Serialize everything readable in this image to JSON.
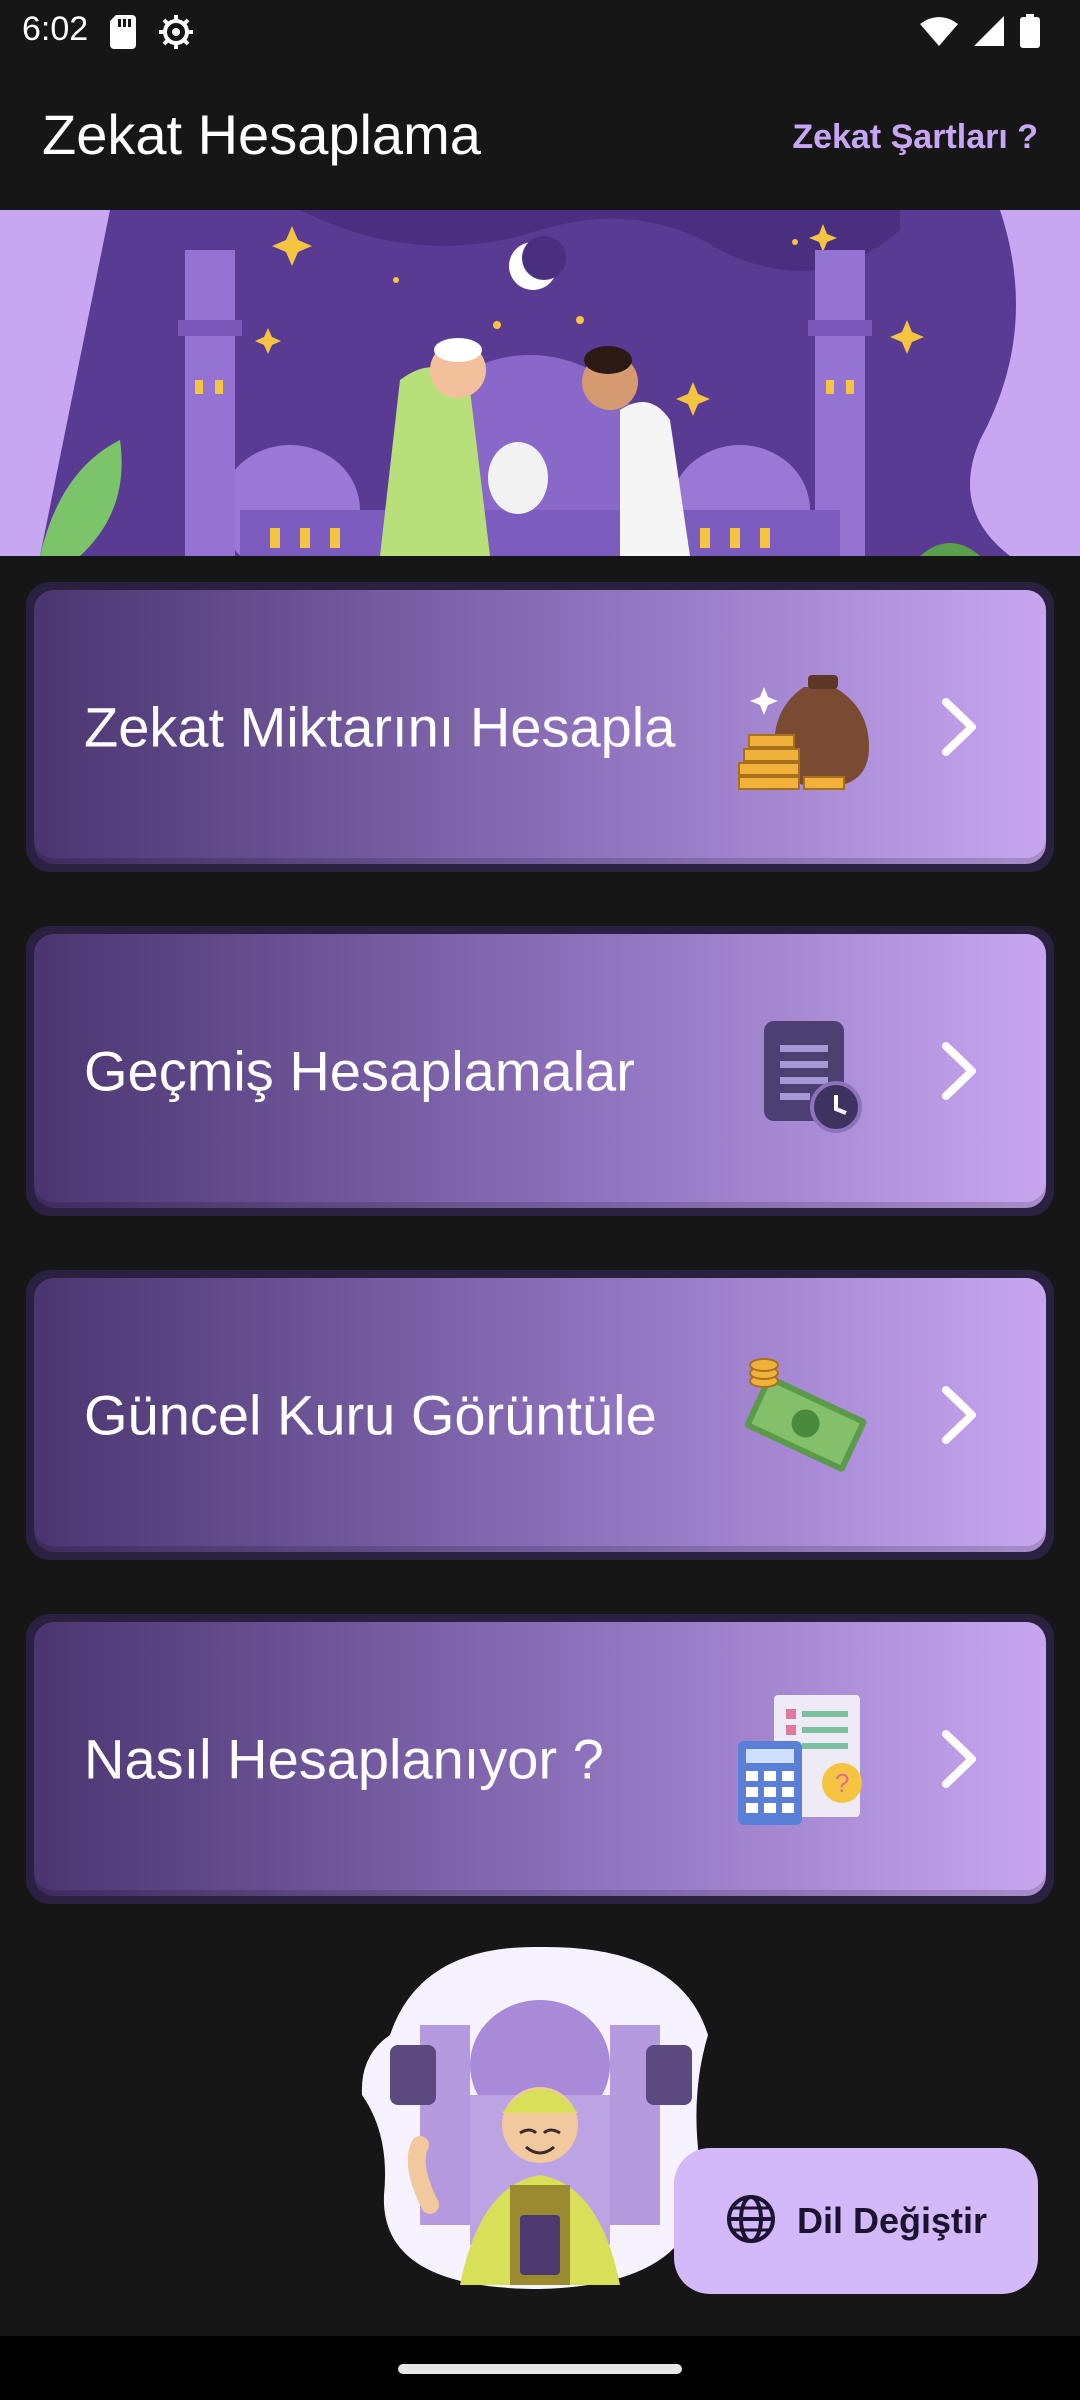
{
  "status_bar": {
    "time": "6:02",
    "icons": [
      "sd-card-icon",
      "settings-icon",
      "wifi-icon",
      "signal-icon",
      "battery-icon"
    ]
  },
  "app_bar": {
    "title": "Zekat Hesaplama",
    "action_label": "Zekat Şartları ?"
  },
  "colors": {
    "background": "#161616",
    "accent": "#c9a6f5",
    "card_gradient_start": "#4a3570",
    "card_gradient_end": "#c7a6ef",
    "fab_background": "#d3b8fa"
  },
  "menu": {
    "items": [
      {
        "label": "Zekat Miktarını Hesapla",
        "icon": "money-bag-icon"
      },
      {
        "label": "Geçmiş Hesaplamalar",
        "icon": "history-document-icon"
      },
      {
        "label": "Güncel Kuru Görüntüle",
        "icon": "banknotes-icon"
      },
      {
        "label": "Nasıl Hesaplanıyor ?",
        "icon": "calculator-icon"
      }
    ]
  },
  "fab": {
    "label": "Dil Değiştir",
    "icon": "globe-icon"
  }
}
